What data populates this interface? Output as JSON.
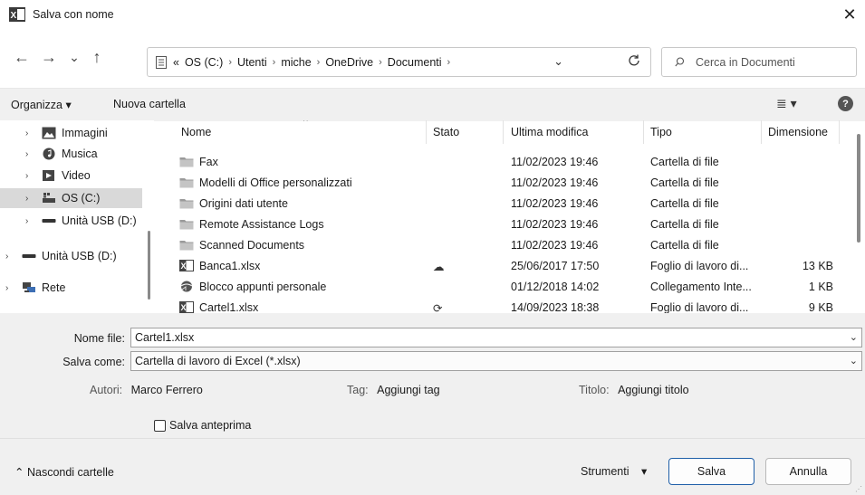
{
  "window": {
    "title": "Salva con nome",
    "close": "✕"
  },
  "nav": {
    "back": "←",
    "forward": "→",
    "recent": "⌄",
    "up": "↑"
  },
  "address": {
    "prefix": "«",
    "path": [
      "OS (C:)",
      "Utenti",
      "miche",
      "OneDrive",
      "Documenti"
    ],
    "sep": "›"
  },
  "search": {
    "placeholder": "Cerca in Documenti"
  },
  "toolbar": {
    "organize": "Organizza ▾",
    "new_folder": "Nuova cartella"
  },
  "sidebar": {
    "items": [
      {
        "label": "Immagini",
        "icon": "image-icon"
      },
      {
        "label": "Musica",
        "icon": "music-icon"
      },
      {
        "label": "Video",
        "icon": "video-icon"
      },
      {
        "label": "OS (C:)",
        "icon": "drive-icon",
        "selected": true
      },
      {
        "label": "Unità USB (D:)",
        "icon": "usb-drive-icon"
      },
      {
        "label": "Unità USB (D:)",
        "icon": "usb-drive-icon"
      },
      {
        "label": "Rete",
        "icon": "network-icon"
      }
    ]
  },
  "columns": {
    "name": "Nome",
    "status": "Stato",
    "modified": "Ultima modifica",
    "type": "Tipo",
    "size": "Dimensione"
  },
  "files": [
    {
      "name": "Fax",
      "status": "",
      "modified": "11/02/2023 19:46",
      "type": "Cartella di file",
      "size": "",
      "icon": "folder-icon"
    },
    {
      "name": "Modelli di Office personalizzati",
      "status": "",
      "modified": "11/02/2023 19:46",
      "type": "Cartella di file",
      "size": "",
      "icon": "folder-icon"
    },
    {
      "name": "Origini dati utente",
      "status": "",
      "modified": "11/02/2023 19:46",
      "type": "Cartella di file",
      "size": "",
      "icon": "folder-icon"
    },
    {
      "name": "Remote Assistance Logs",
      "status": "",
      "modified": "11/02/2023 19:46",
      "type": "Cartella di file",
      "size": "",
      "icon": "folder-icon"
    },
    {
      "name": "Scanned Documents",
      "status": "",
      "modified": "11/02/2023 19:46",
      "type": "Cartella di file",
      "size": "",
      "icon": "folder-icon"
    },
    {
      "name": "Banca1.xlsx",
      "status": "☁",
      "modified": "25/06/2017 17:50",
      "type": "Foglio di lavoro di...",
      "size": "13 KB",
      "icon": "excel-file-icon"
    },
    {
      "name": "Blocco appunti personale",
      "status": "",
      "modified": "01/12/2018 14:02",
      "type": "Collegamento Inte...",
      "size": "1 KB",
      "icon": "onenote-shortcut-icon"
    },
    {
      "name": "Cartel1.xlsx",
      "status": "⟳",
      "modified": "14/09/2023 18:38",
      "type": "Foglio di lavoro di...",
      "size": "9 KB",
      "icon": "excel-file-icon"
    }
  ],
  "form": {
    "filename_label": "Nome file:",
    "filename_value": "Cartel1.xlsx",
    "savetype_label": "Salva come:",
    "savetype_value": "Cartella di lavoro di Excel (*.xlsx)",
    "authors_label": "Autori:",
    "authors_value": "Marco Ferrero",
    "tags_label": "Tag:",
    "tags_value": "Aggiungi tag",
    "title_label": "Titolo:",
    "title_value": "Aggiungi titolo",
    "thumbnail_label": "Salva anteprima"
  },
  "footer": {
    "hide_folders": "Nascondi cartelle",
    "tools": "Strumenti",
    "save": "Salva",
    "cancel": "Annulla"
  },
  "colors": {
    "accent": "#1f5fa8",
    "selected": "#d9d9d9",
    "panel": "#f0f0f0"
  }
}
